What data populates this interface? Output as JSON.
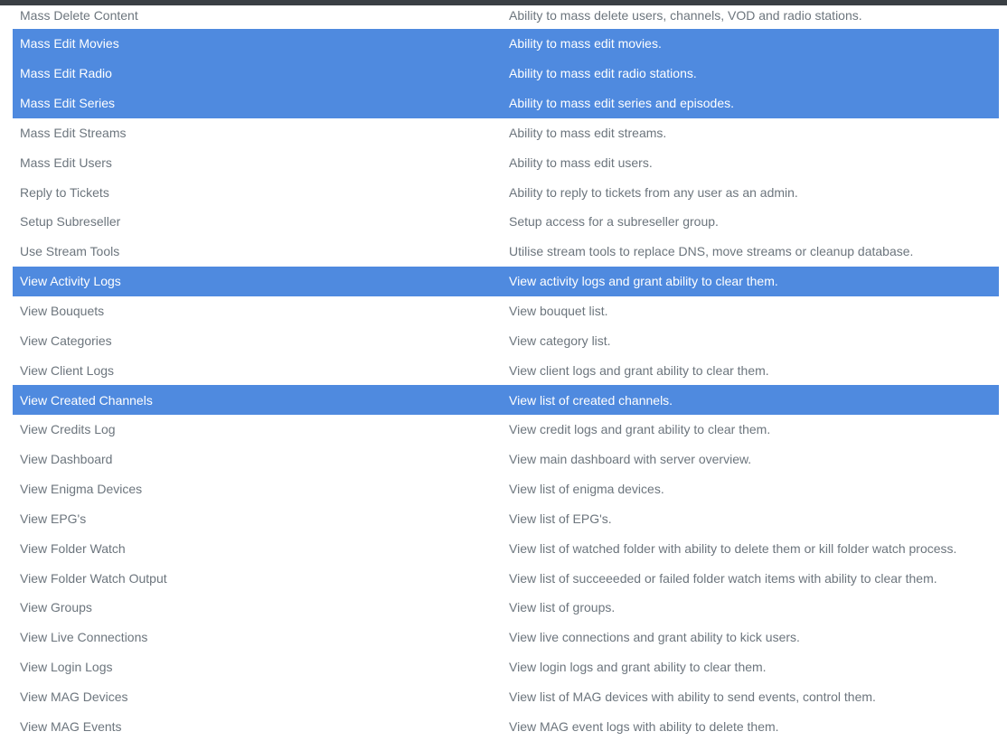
{
  "colors": {
    "selected_bg": "#4f8adf",
    "text": "#6c757d",
    "selected_text": "#ffffff",
    "top_bar": "#3a3f44"
  },
  "permissions": [
    {
      "name": "Mass Delete Content",
      "description": "Ability to mass delete users, channels, VOD and radio stations.",
      "selected": false
    },
    {
      "name": "Mass Edit Movies",
      "description": "Ability to mass edit movies.",
      "selected": true
    },
    {
      "name": "Mass Edit Radio",
      "description": "Ability to mass edit radio stations.",
      "selected": true
    },
    {
      "name": "Mass Edit Series",
      "description": "Ability to mass edit series and episodes.",
      "selected": true
    },
    {
      "name": "Mass Edit Streams",
      "description": "Ability to mass edit streams.",
      "selected": false
    },
    {
      "name": "Mass Edit Users",
      "description": "Ability to mass edit users.",
      "selected": false
    },
    {
      "name": "Reply to Tickets",
      "description": "Ability to reply to tickets from any user as an admin.",
      "selected": false
    },
    {
      "name": "Setup Subreseller",
      "description": "Setup access for a subreseller group.",
      "selected": false
    },
    {
      "name": "Use Stream Tools",
      "description": "Utilise stream tools to replace DNS, move streams or cleanup database.",
      "selected": false
    },
    {
      "name": "View Activity Logs",
      "description": "View activity logs and grant ability to clear them.",
      "selected": true
    },
    {
      "name": "View Bouquets",
      "description": "View bouquet list.",
      "selected": false
    },
    {
      "name": "View Categories",
      "description": "View category list.",
      "selected": false
    },
    {
      "name": "View Client Logs",
      "description": "View client logs and grant ability to clear them.",
      "selected": false
    },
    {
      "name": "View Created Channels",
      "description": "View list of created channels.",
      "selected": true
    },
    {
      "name": "View Credits Log",
      "description": "View credit logs and grant ability to clear them.",
      "selected": false
    },
    {
      "name": "View Dashboard",
      "description": "View main dashboard with server overview.",
      "selected": false
    },
    {
      "name": "View Enigma Devices",
      "description": "View list of enigma devices.",
      "selected": false
    },
    {
      "name": "View EPG's",
      "description": "View list of EPG's.",
      "selected": false
    },
    {
      "name": "View Folder Watch",
      "description": "View list of watched folder with ability to delete them or kill folder watch process.",
      "selected": false
    },
    {
      "name": "View Folder Watch Output",
      "description": "View list of succeeeded or failed folder watch items with ability to clear them.",
      "selected": false
    },
    {
      "name": "View Groups",
      "description": "View list of groups.",
      "selected": false
    },
    {
      "name": "View Live Connections",
      "description": "View live connections and grant ability to kick users.",
      "selected": false
    },
    {
      "name": "View Login Logs",
      "description": "View login logs and grant ability to clear them.",
      "selected": false
    },
    {
      "name": "View MAG Devices",
      "description": "View list of MAG devices with ability to send events, control them.",
      "selected": false
    },
    {
      "name": "View MAG Events",
      "description": "View MAG event logs with ability to delete them.",
      "selected": false
    }
  ]
}
